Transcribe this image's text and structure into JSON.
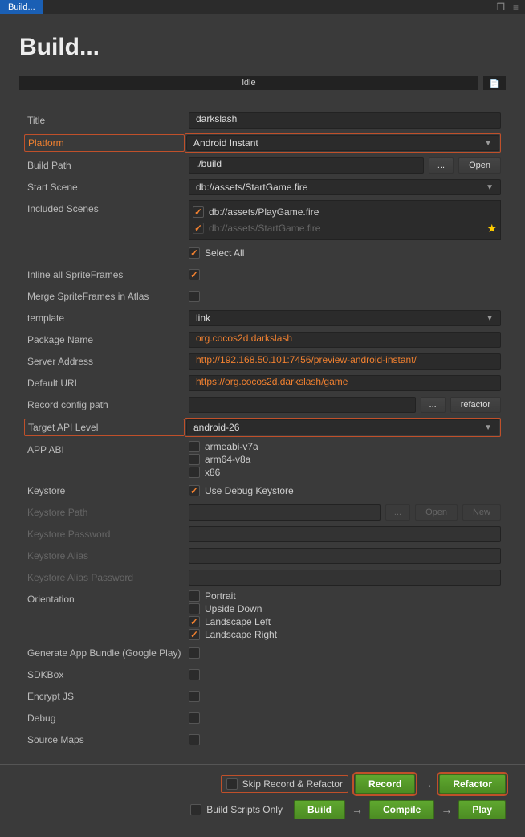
{
  "titlebar": {
    "tab": "Build..."
  },
  "page_title": "Build...",
  "status": {
    "text": "idle"
  },
  "labels": {
    "title": "Title",
    "platform": "Platform",
    "build_path": "Build Path",
    "start_scene": "Start Scene",
    "included_scenes": "Included Scenes",
    "select_all": "Select All",
    "inline_spriteframes": "Inline all SpriteFrames",
    "merge_spriteframes": "Merge SpriteFrames in Atlas",
    "template": "template",
    "package_name": "Package Name",
    "server_address": "Server Address",
    "default_url": "Default URL",
    "record_config_path": "Record config path",
    "target_api_level": "Target API Level",
    "app_abi": "APP ABI",
    "keystore": "Keystore",
    "use_debug_keystore": "Use Debug Keystore",
    "keystore_path": "Keystore Path",
    "keystore_password": "Keystore Password",
    "keystore_alias": "Keystore Alias",
    "keystore_alias_password": "Keystore Alias Password",
    "orientation": "Orientation",
    "generate_app_bundle": "Generate App Bundle (Google Play)",
    "sdkbox": "SDKBox",
    "encrypt_js": "Encrypt JS",
    "debug": "Debug",
    "source_maps": "Source Maps"
  },
  "values": {
    "title": "darkslash",
    "platform": "Android Instant",
    "build_path": "./build",
    "start_scene": "db://assets/StartGame.fire",
    "template": "link",
    "package_name": "org.cocos2d.darkslash",
    "server_address": "http://192.168.50.101:7456/preview-android-instant/",
    "default_url": "https://org.cocos2d.darkslash/game",
    "record_config_path": "",
    "target_api_level": "android-26"
  },
  "scenes": {
    "items": [
      {
        "path": "db://assets/PlayGame.fire",
        "checked": true,
        "faded": false
      },
      {
        "path": "db://assets/StartGame.fire",
        "checked": true,
        "faded": true,
        "star": true
      }
    ]
  },
  "app_abi": {
    "armeabi_v7a": "armeabi-v7a",
    "arm64_v8a": "arm64-v8a",
    "x86": "x86"
  },
  "orientation": {
    "portrait": "Portrait",
    "upside_down": "Upside Down",
    "landscape_left": "Landscape Left",
    "landscape_right": "Landscape Right"
  },
  "buttons": {
    "ellipsis": "...",
    "open": "Open",
    "refactor": "refactor",
    "new": "New",
    "skip_record": "Skip Record & Refactor",
    "record": "Record",
    "refactor_btn": "Refactor",
    "build_scripts_only": "Build Scripts Only",
    "build": "Build",
    "compile": "Compile",
    "play": "Play"
  }
}
